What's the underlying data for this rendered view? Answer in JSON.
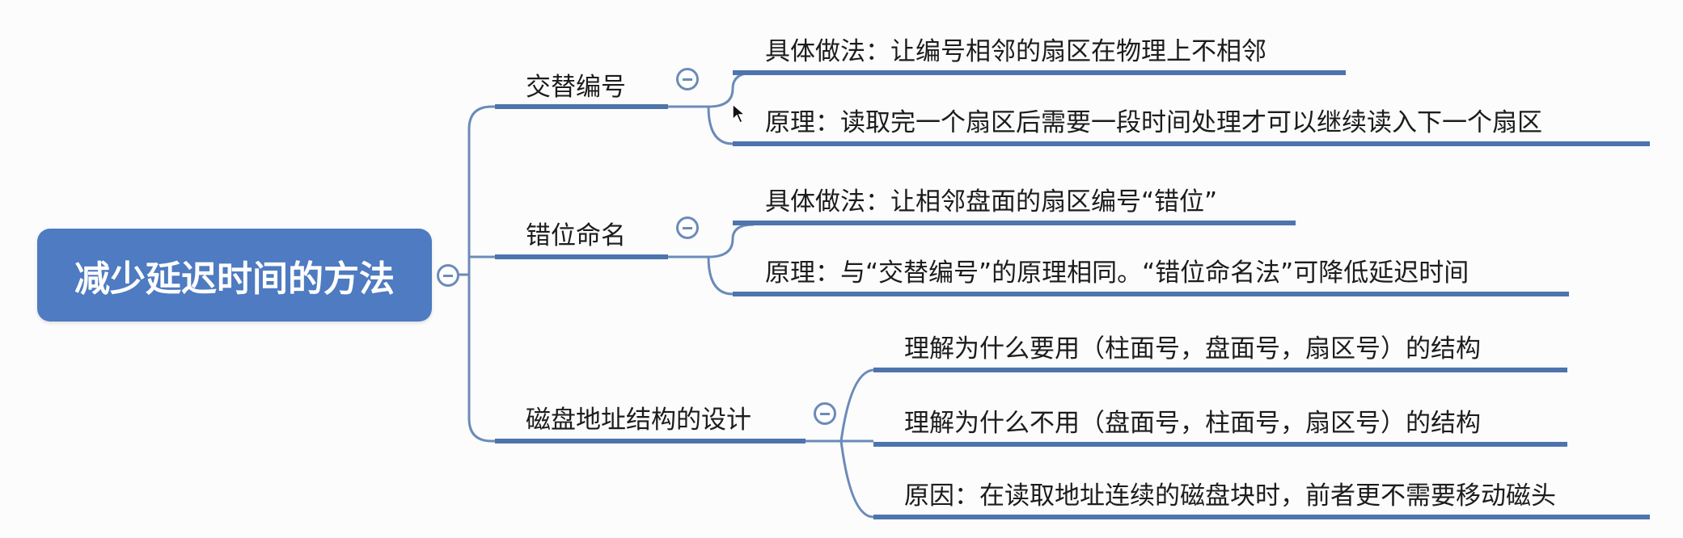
{
  "central": {
    "label": "减少延迟时间的方法"
  },
  "branches": [
    {
      "label": "交替编号",
      "children": [
        "具体做法：让编号相邻的扇区在物理上不相邻",
        "原理：读取完一个扇区后需要一段时间处理才可以继续读入下一个扇区"
      ]
    },
    {
      "label": "错位命名",
      "children": [
        "具体做法：让相邻盘面的扇区编号“错位”",
        "原理：与“交替编号”的原理相同。“错位命名法”可降低延迟时间"
      ]
    },
    {
      "label": "磁盘地址结构的设计",
      "children": [
        "理解为什么要用（柱面号，盘面号，扇区号）的结构",
        "理解为什么不用（盘面号，柱面号，扇区号）的结构",
        "原因：在读取地址连续的磁盘块时，前者更不需要移动磁头"
      ]
    }
  ],
  "colors": {
    "central_fill": "#4e7bc1",
    "underline": "#4d74ad",
    "connector": "#6b8bb8"
  },
  "icons": {
    "collapse": "minus-circle-icon",
    "cursor": "mouse-pointer-icon"
  }
}
